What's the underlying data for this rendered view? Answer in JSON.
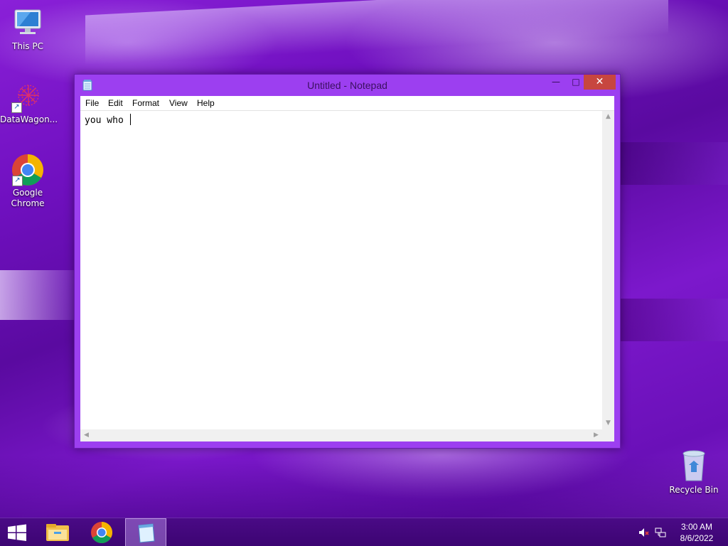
{
  "desktop": {
    "icons": [
      {
        "label": "This PC",
        "icon": "computer-icon"
      },
      {
        "label": "DataWagon...",
        "icon": "datawagon-icon"
      },
      {
        "label": "Google Chrome",
        "icon": "chrome-icon"
      }
    ],
    "recycle_bin": {
      "label": "Recycle Bin",
      "icon": "recycle-bin-icon"
    }
  },
  "notepad": {
    "title": "Untitled - Notepad",
    "window_buttons": {
      "minimize": "—",
      "maximize": "□",
      "close": "✕"
    },
    "menu": [
      "File",
      "Edit",
      "Format",
      "View",
      "Help"
    ],
    "content": "you who "
  },
  "taskbar": {
    "items": [
      "start-icon",
      "file-explorer-icon",
      "chrome-icon",
      "notepad-icon"
    ],
    "clock": {
      "time": "3:00 AM",
      "date": "8/6/2022"
    }
  },
  "colors": {
    "window_frame": "#9c3ff0",
    "close_button": "#c7463f",
    "taskbar": "#3c0572"
  }
}
